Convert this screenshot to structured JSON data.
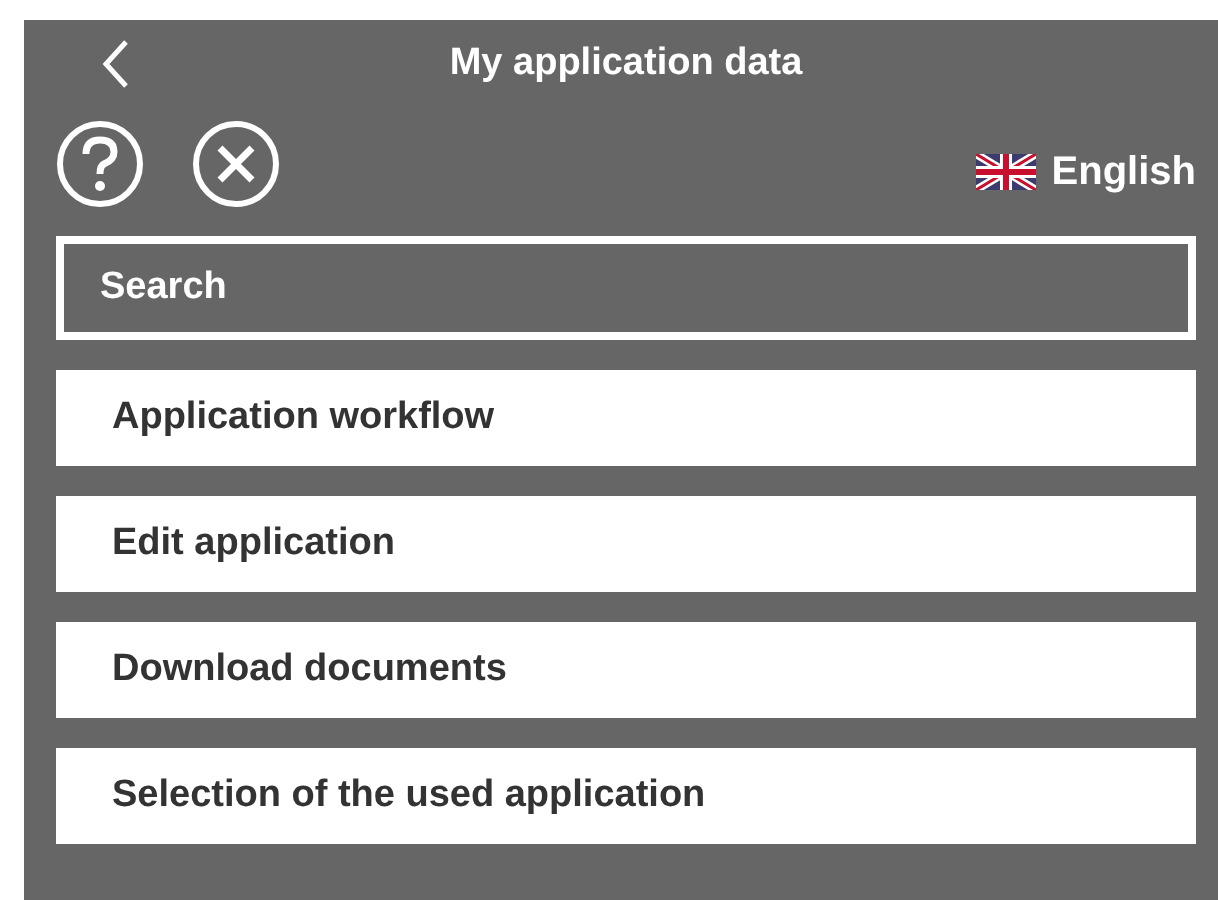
{
  "header": {
    "title": "My application data"
  },
  "language": {
    "label": "English"
  },
  "search": {
    "placeholder": "Search"
  },
  "menu": [
    {
      "label": "Application workflow"
    },
    {
      "label": "Edit application"
    },
    {
      "label": "Download documents"
    },
    {
      "label": "Selection of the used application"
    }
  ]
}
